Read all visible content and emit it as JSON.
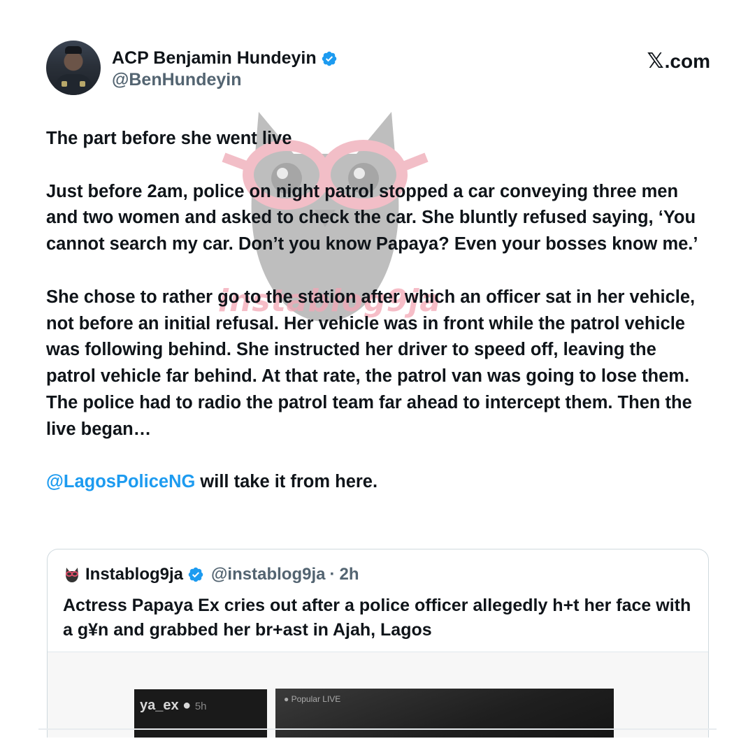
{
  "author": {
    "name": "ACP Benjamin Hundeyin",
    "handle": "@BenHundeyin",
    "verified": true
  },
  "site": {
    "label": ".com",
    "logo": "𝕏"
  },
  "tweet": {
    "p1": "The part before she went live",
    "p2": "Just before 2am, police on night patrol stopped a car conveying three men and two women and asked to check the car. She bluntly refused saying, ‘You cannot search my car. Don’t you know Papaya? Even your bosses know me.’",
    "p3": "She chose to rather go to the station after which an officer sat in her vehicle, not before an initial refusal. Her vehicle was in front while the patrol vehicle was following behind. She instructed her driver to speed off, leaving the patrol vehicle far behind. At that rate, the patrol van was going to lose them. The police had to radio the patrol team far ahead to intercept them. Then the live began…",
    "p4_mention": "@LagosPoliceNG",
    "p4_rest": " will take it from here."
  },
  "watermark": {
    "text": "instablog9ja"
  },
  "quote": {
    "name": "Instablog9ja",
    "handle": "@instablog9ja",
    "separator": "·",
    "time": "2h",
    "text": "Actress Papaya Ex cries out after a police officer allegedly h+t her face with a g¥n and grabbed her br+ast in Ajah, Lagos",
    "media": {
      "clip1_user": "ya_ex ●",
      "clip1_time": "5h",
      "clip2_label": "● Popular LIVE"
    }
  },
  "colors": {
    "link": "#1d9bf0",
    "verified": "#1d9bf0",
    "text": "#0f1419",
    "secondary": "#536471"
  },
  "icons": [
    "verified-badge-icon",
    "x-logo-icon",
    "owl-watermark-icon"
  ]
}
